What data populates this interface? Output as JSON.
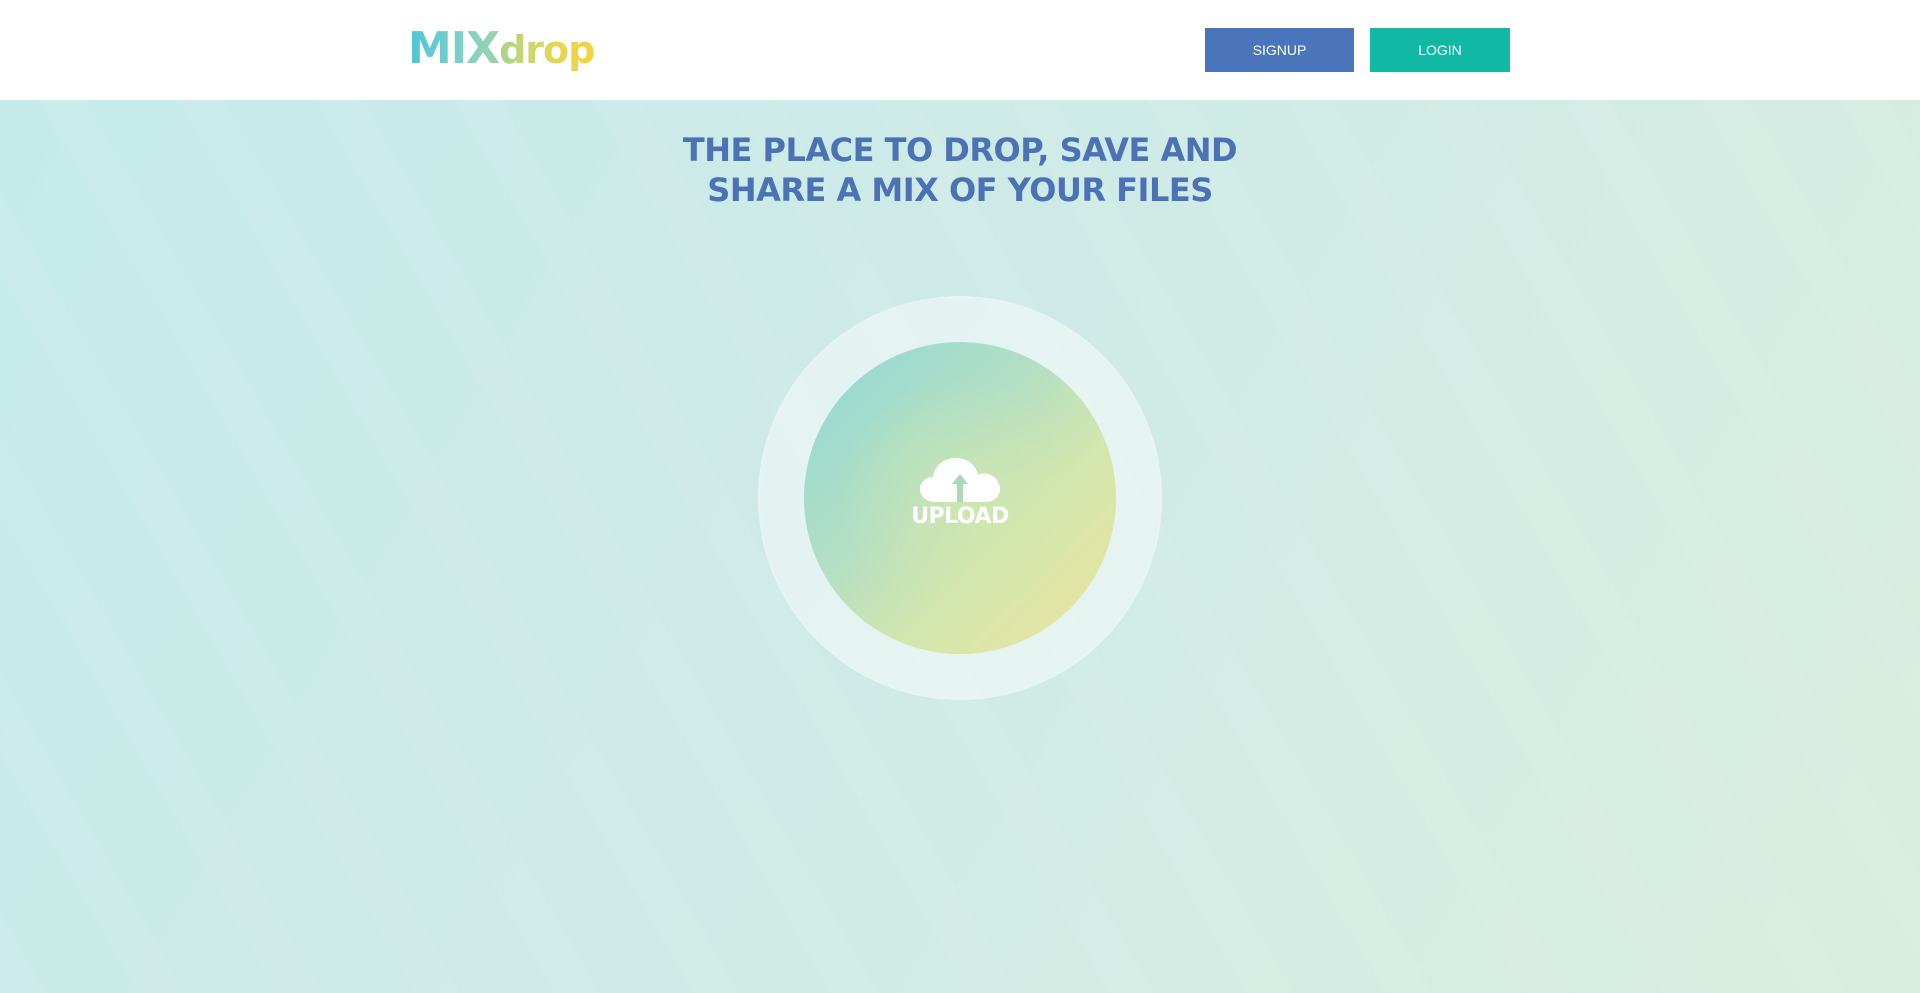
{
  "header": {
    "logo": {
      "part1": "MIX",
      "part2": "drop"
    },
    "signup_label": "SIGNUP",
    "login_label": "LOGIN"
  },
  "hero": {
    "headline_line1": "THE PLACE TO DROP, SAVE AND",
    "headline_line2": "SHARE A MIX OF YOUR FILES",
    "upload_label": "UPLOAD",
    "upload_icon": "cloud-upload-icon"
  },
  "colors": {
    "signup_button": "#4b75ba",
    "login_button": "#11b8a3",
    "headline": "#4a72b5",
    "background": "#cdeae7"
  }
}
